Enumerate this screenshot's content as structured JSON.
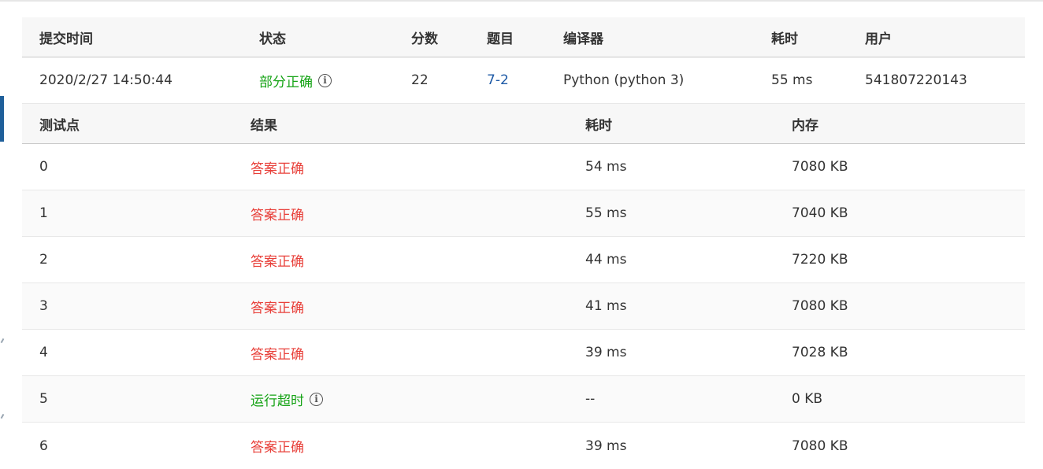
{
  "submission": {
    "headers": {
      "time": "提交时间",
      "status": "状态",
      "score": "分数",
      "problem": "题目",
      "compiler": "编译器",
      "elapsed": "耗时",
      "user": "用户"
    },
    "row": {
      "time": "2020/2/27 14:50:44",
      "status": "部分正确",
      "score": "22",
      "problem": "7-2",
      "compiler": "Python (python 3)",
      "elapsed": "55 ms",
      "user": "541807220143"
    }
  },
  "testcases": {
    "headers": {
      "point": "测试点",
      "result": "结果",
      "elapsed": "耗时",
      "memory": "内存"
    },
    "rows": [
      {
        "point": "0",
        "result": "答案正确",
        "elapsed": "54 ms",
        "memory": "7080 KB"
      },
      {
        "point": "1",
        "result": "答案正确",
        "elapsed": "55 ms",
        "memory": "7040 KB"
      },
      {
        "point": "2",
        "result": "答案正确",
        "elapsed": "44 ms",
        "memory": "7220 KB"
      },
      {
        "point": "3",
        "result": "答案正确",
        "elapsed": "41 ms",
        "memory": "7080 KB"
      },
      {
        "point": "4",
        "result": "答案正确",
        "elapsed": "39 ms",
        "memory": "7028 KB"
      },
      {
        "point": "5",
        "result": "运行超时",
        "elapsed": "--",
        "memory": "0 KB"
      },
      {
        "point": "6",
        "result": "答案正确",
        "elapsed": "39 ms",
        "memory": "7080 KB"
      }
    ]
  },
  "icons": {
    "info": "info-circle-icon"
  },
  "colors": {
    "accepted": "#e8403a",
    "partial": "#15a315",
    "timeout": "#15a315",
    "link": "#1e5aa6"
  }
}
